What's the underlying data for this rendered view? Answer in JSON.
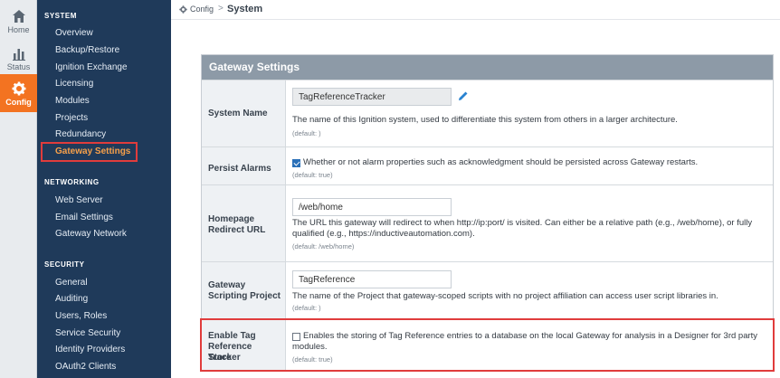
{
  "rail": {
    "items": [
      {
        "label": "Home",
        "icon": "home-icon"
      },
      {
        "label": "Status",
        "icon": "bar-chart-icon"
      },
      {
        "label": "Config",
        "icon": "gear-icon",
        "active": true
      }
    ]
  },
  "sidebar": {
    "sections": [
      {
        "title": "SYSTEM",
        "items": [
          "Overview",
          "Backup/Restore",
          "Ignition Exchange",
          "Licensing",
          "Modules",
          "Projects",
          "Redundancy",
          "Gateway Settings"
        ]
      },
      {
        "title": "NETWORKING",
        "items": [
          "Web Server",
          "Email Settings",
          "Gateway Network"
        ]
      },
      {
        "title": "SECURITY",
        "items": [
          "General",
          "Auditing",
          "Users, Roles",
          "Service Security",
          "Identity Providers",
          "OAuth2 Clients"
        ]
      }
    ],
    "active_item": "Gateway Settings"
  },
  "breadcrumb": {
    "root": "Config",
    "separator": ">",
    "current": "System"
  },
  "panel": {
    "title": "Gateway Settings",
    "rows": [
      {
        "label": "System Name",
        "value": "TagReferenceTracker",
        "description": "The name of this Ignition system, used to differentiate this system from others in a larger architecture.",
        "default": "(default: )"
      },
      {
        "label": "Persist Alarms",
        "checked": true,
        "description": "Whether or not alarm properties such as acknowledgment should be persisted across Gateway restarts.",
        "default": "(default: true)"
      },
      {
        "label_lines": [
          "Homepage",
          "Redirect URL"
        ],
        "value": "/web/home",
        "description_lines": [
          "The URL this gateway will redirect to when http://ip:port/ is visited. Can either be a relative path (e.g., /web/home), or fully",
          "qualified (e.g., https://inductiveautomation.com)."
        ],
        "default": "(default: /web/home)"
      },
      {
        "label_lines": [
          "Gateway",
          "Scripting Project"
        ],
        "value": "TagReference",
        "description": "The name of the Project that gateway-scoped scripts with no project affiliation can access user script libraries in.",
        "default": "(default: )"
      },
      {
        "label_lines": [
          "Enable Tag",
          "Reference Tracker",
          "Store"
        ],
        "checked": false,
        "description_lines": [
          "Enables the storing of Tag Reference entries to a database on the local Gateway for analysis in a Designer for 3rd party",
          "modules."
        ],
        "default": "(default: true)"
      }
    ]
  },
  "colors": {
    "accent": "#f37321",
    "sidebar_bg": "#1f3a5a",
    "highlight": "#e03c3c",
    "header_bg": "#8d9aa7"
  }
}
